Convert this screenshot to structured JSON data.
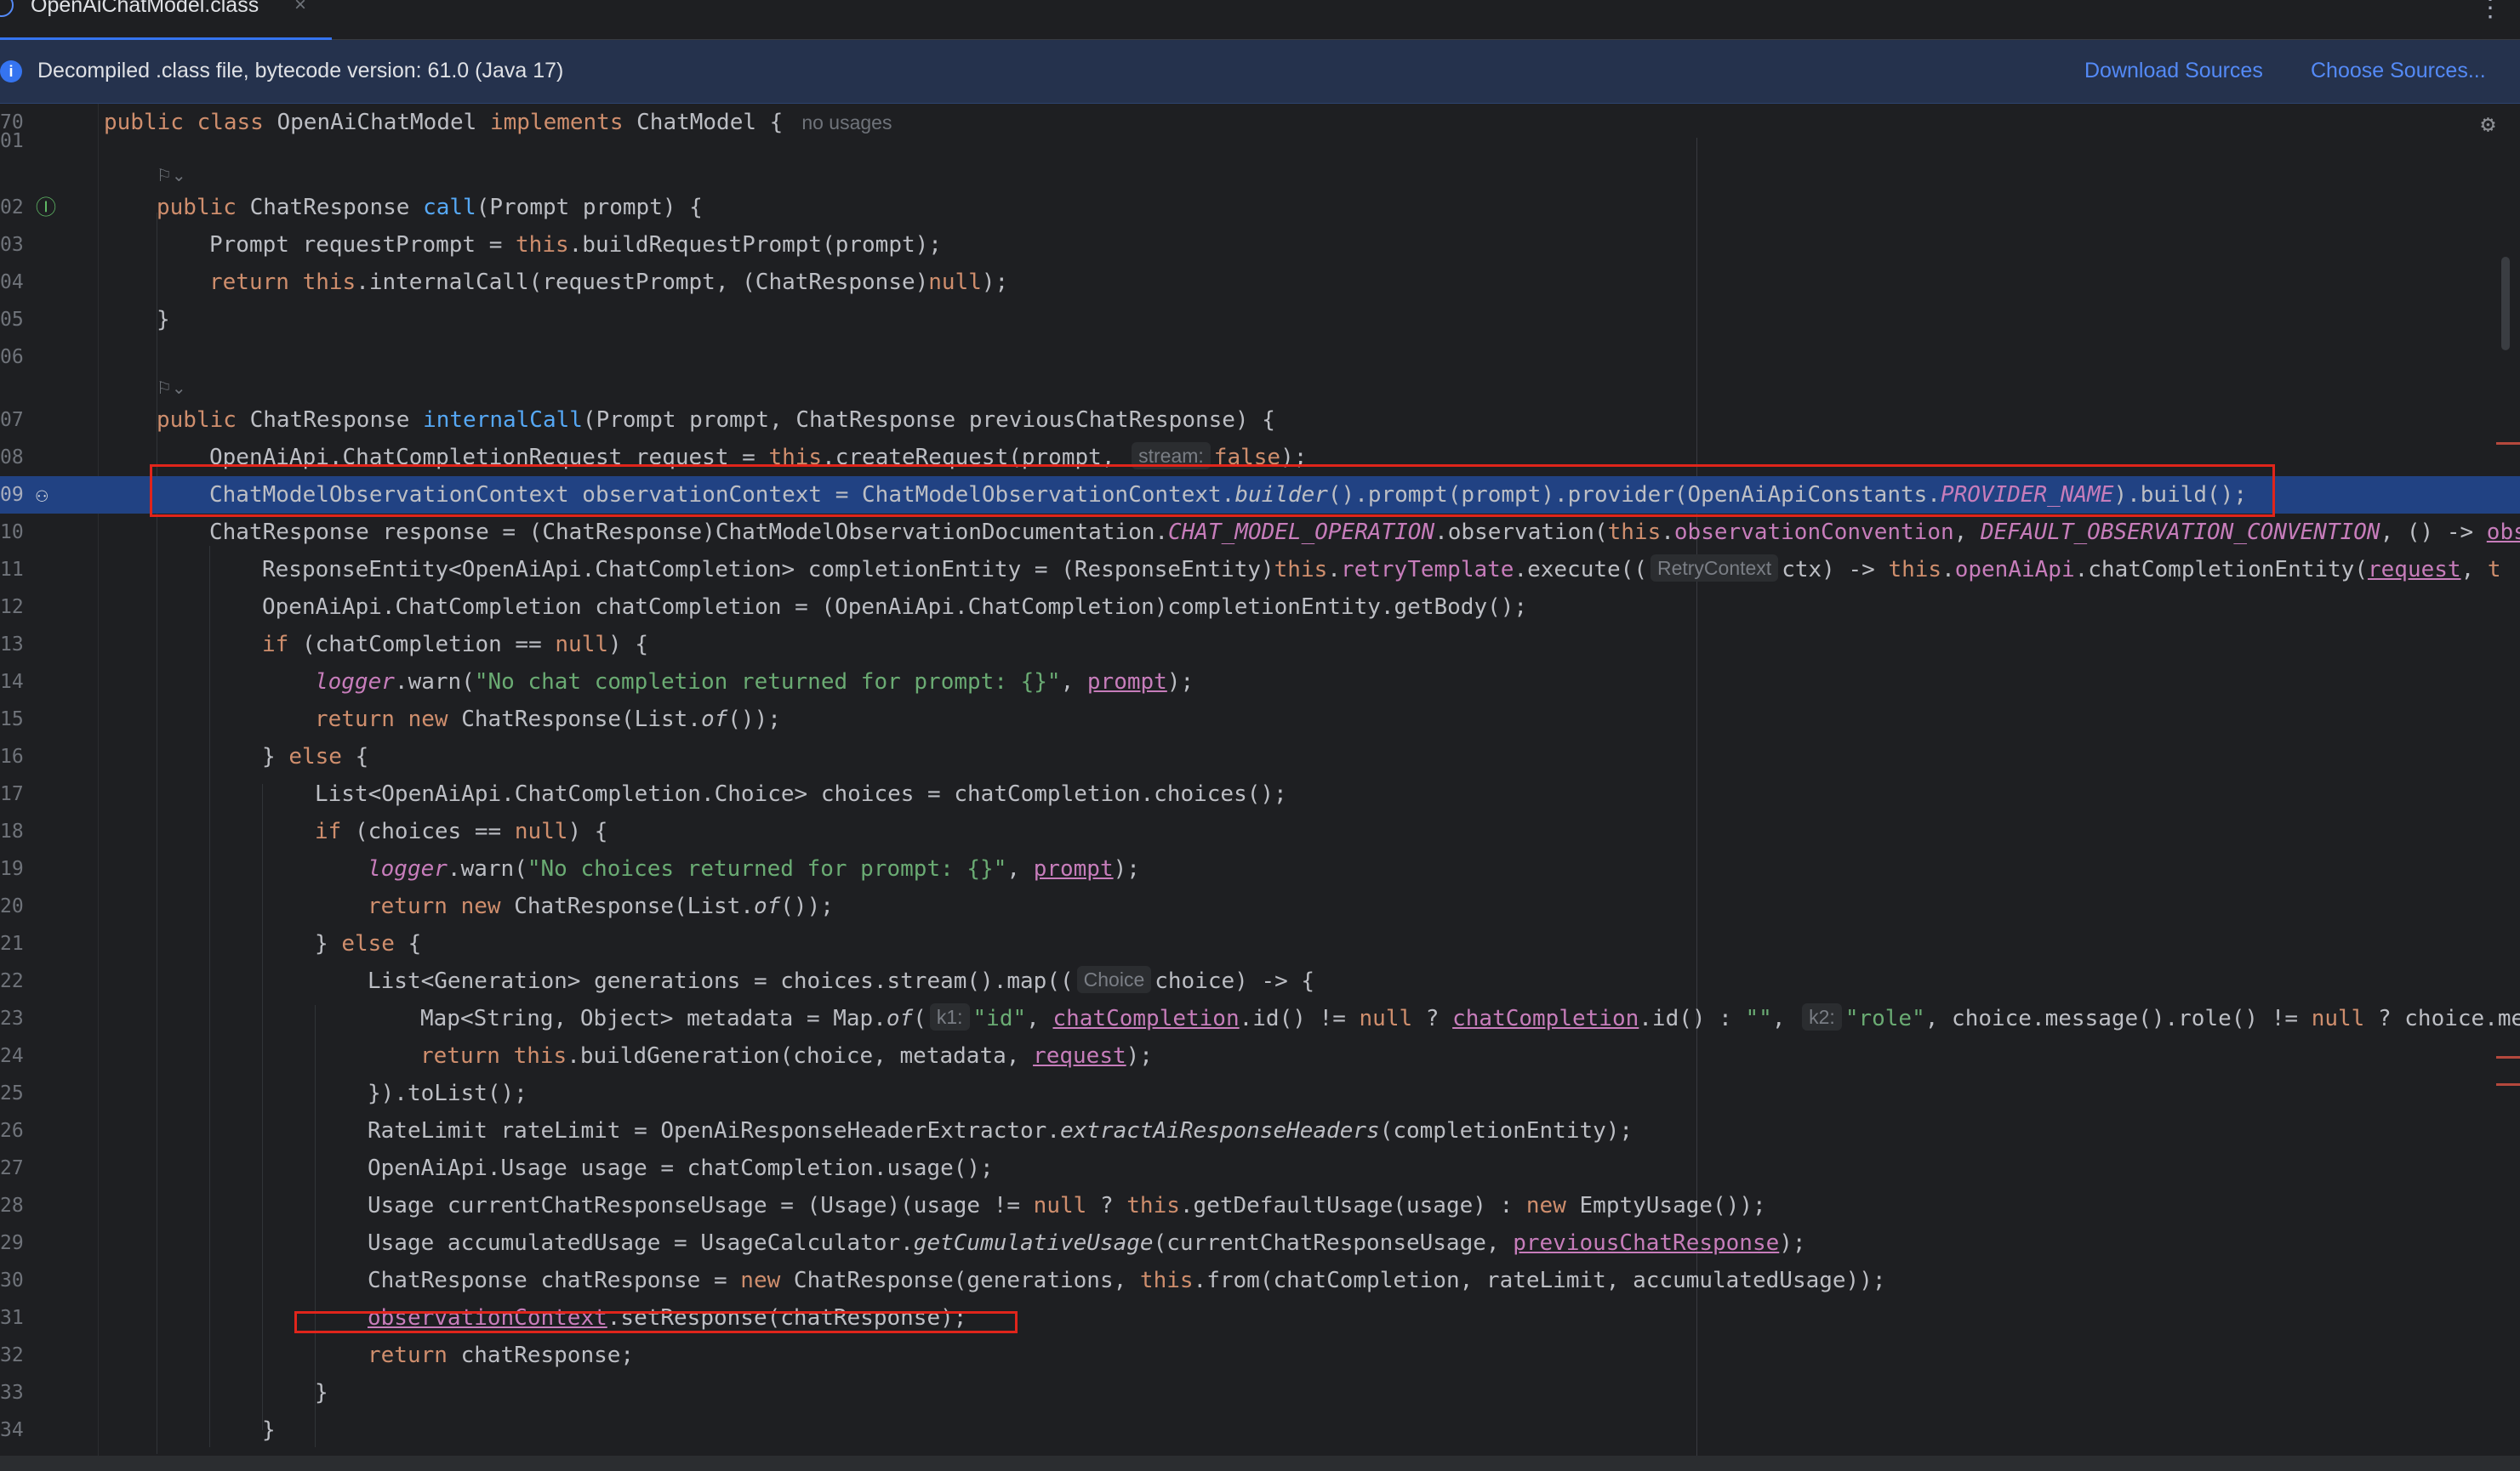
{
  "tab": {
    "title": "OpenAiChatModel.class",
    "close": "×",
    "more": "⋮"
  },
  "banner": {
    "message": "Decompiled .class file, bytecode version: 61.0 (Java 17)",
    "download": "Download Sources",
    "choose": "Choose Sources..."
  },
  "lines": [
    {
      "n": "70",
      "code": "public class OpenAiChatModel implements ChatModel {"
    },
    {
      "n": "01",
      "code": ""
    },
    {
      "n": "02",
      "code": "public ChatResponse call(Prompt prompt) {"
    },
    {
      "n": "03",
      "code": "Prompt requestPrompt = this.buildRequestPrompt(prompt);"
    },
    {
      "n": "04",
      "code": "return this.internalCall(requestPrompt, (ChatResponse)null);"
    },
    {
      "n": "05",
      "code": "}"
    },
    {
      "n": "06",
      "code": ""
    },
    {
      "n": "07",
      "code": "public ChatResponse internalCall(Prompt prompt, ChatResponse previousChatResponse) {"
    },
    {
      "n": "08",
      "code": "OpenAiApi.ChatCompletionRequest request = this.createRequest(prompt, false);"
    },
    {
      "n": "09",
      "code": "ChatModelObservationContext observationContext = ChatModelObservationContext.builder().prompt(prompt).provider(OpenAiApiConstants.PROVIDER_NAME).build();"
    },
    {
      "n": "10",
      "code": "ChatResponse response = (ChatResponse)ChatModelObservationDocumentation.CHAT_MODEL_OPERATION.observation(this.observationConvention, DEFAULT_OBSERVATION_CONVENTION, () -> obs"
    },
    {
      "n": "11",
      "code": "ResponseEntity<OpenAiApi.ChatCompletion> completionEntity = (ResponseEntity)this.retryTemplate.execute((ctx) -> this.openAiApi.chatCompletionEntity(request, t"
    },
    {
      "n": "12",
      "code": "OpenAiApi.ChatCompletion chatCompletion = (OpenAiApi.ChatCompletion)completionEntity.getBody();"
    },
    {
      "n": "13",
      "code": "if (chatCompletion == null) {"
    },
    {
      "n": "14",
      "code": "logger.warn(\"No chat completion returned for prompt: {}\", prompt);"
    },
    {
      "n": "15",
      "code": "return new ChatResponse(List.of());"
    },
    {
      "n": "16",
      "code": "} else {"
    },
    {
      "n": "17",
      "code": "List<OpenAiApi.ChatCompletion.Choice> choices = chatCompletion.choices();"
    },
    {
      "n": "18",
      "code": "if (choices == null) {"
    },
    {
      "n": "19",
      "code": "logger.warn(\"No choices returned for prompt: {}\", prompt);"
    },
    {
      "n": "20",
      "code": "return new ChatResponse(List.of());"
    },
    {
      "n": "21",
      "code": "} else {"
    },
    {
      "n": "22",
      "code": "List<Generation> generations = choices.stream().map((choice) -> {"
    },
    {
      "n": "23",
      "code": "Map<String, Object> metadata = Map.of(\"id\", chatCompletion.id() != null ? chatCompletion.id() : \"\", \"role\", choice.message().role() != null ? choice.me"
    },
    {
      "n": "24",
      "code": "return this.buildGeneration(choice, metadata, request);"
    },
    {
      "n": "25",
      "code": "}).toList();"
    },
    {
      "n": "26",
      "code": "RateLimit rateLimit = OpenAiResponseHeaderExtractor.extractAiResponseHeaders(completionEntity);"
    },
    {
      "n": "27",
      "code": "OpenAiApi.Usage usage = chatCompletion.usage();"
    },
    {
      "n": "28",
      "code": "Usage currentChatResponseUsage = (Usage)(usage != null ? this.getDefaultUsage(usage) : new EmptyUsage());"
    },
    {
      "n": "29",
      "code": "Usage accumulatedUsage = UsageCalculator.getCumulativeUsage(currentChatResponseUsage, previousChatResponse);"
    },
    {
      "n": "30",
      "code": "ChatResponse chatResponse = new ChatResponse(generations, this.from(chatCompletion, rateLimit, accumulatedUsage));"
    },
    {
      "n": "31",
      "code": "observationContext.setResponse(chatResponse);"
    },
    {
      "n": "32",
      "code": "return chatResponse;"
    },
    {
      "n": "33",
      "code": "}"
    },
    {
      "n": "34",
      "code": "}"
    }
  ],
  "hints": {
    "no_usages": "no usages",
    "stream": "stream:",
    "retry": "RetryContext",
    "choice": "Choice",
    "k1": "k1:",
    "k2": "k2:"
  },
  "icons": {
    "info": "info-icon",
    "settings": "gear-icon",
    "override": "override-gutter-icon",
    "debug": "bug-gutter-icon"
  },
  "colors": {
    "background": "#1e1f22",
    "keyword": "#cf8e6d",
    "method": "#56a8f5",
    "string": "#6aab73",
    "field": "#c77dbb",
    "selection": "#214283",
    "annotation_box": "#e0251b",
    "link": "#548af7"
  }
}
